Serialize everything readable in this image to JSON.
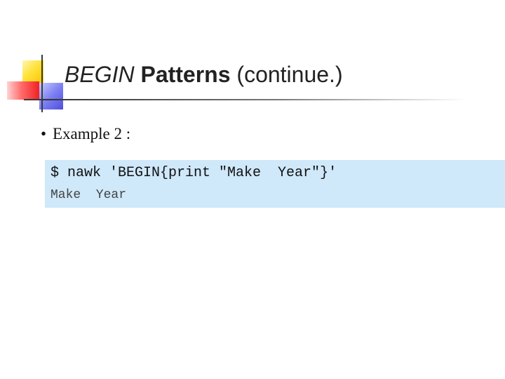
{
  "slide": {
    "title": {
      "italic_part": "BEGIN",
      "bold_part": "Patterns",
      "normal_part": "(continue.)"
    },
    "bullet": {
      "glyph": "•",
      "text": "Example 2 :"
    },
    "code": {
      "command": "$ nawk 'BEGIN{print \"Make  Year\"}'",
      "output": "Make  Year"
    },
    "colors": {
      "code_background": "#cfe8fa",
      "logo_yellow": "#ffe23a",
      "logo_red": "#f12222",
      "logo_blue": "#4e4fdc"
    }
  }
}
